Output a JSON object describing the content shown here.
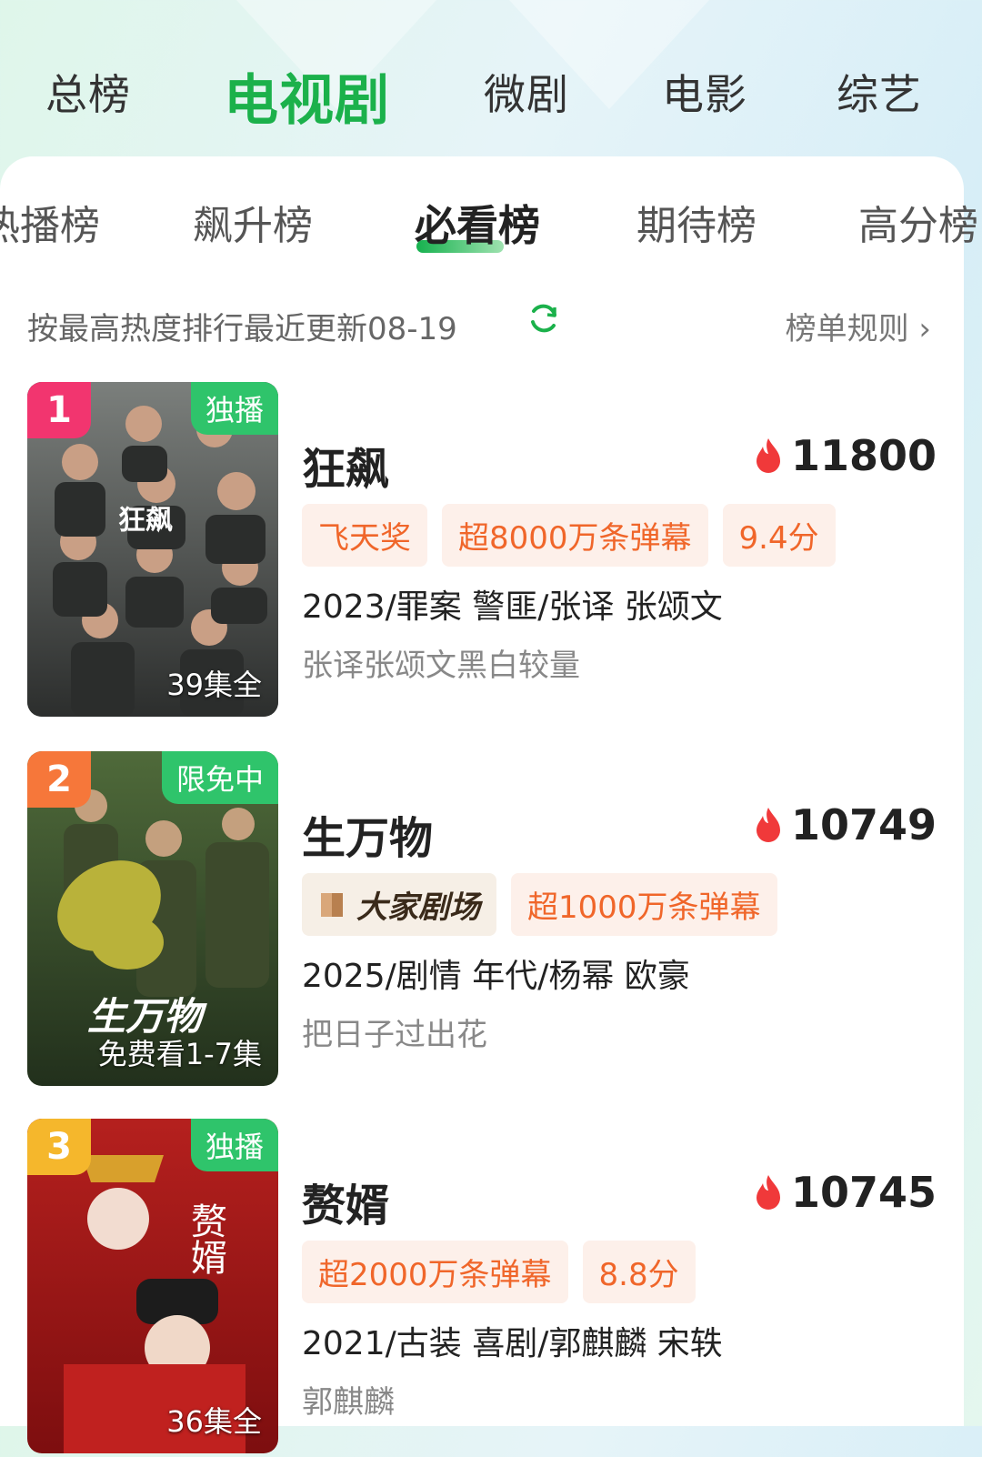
{
  "top_tabs": [
    "总榜",
    "电视剧",
    "微剧",
    "电影",
    "综艺"
  ],
  "sub_tabs": [
    "热播榜",
    "飙升榜",
    "必看榜",
    "期待榜",
    "高分榜"
  ],
  "info": {
    "sort_text": "按最高热度排行最近更新08-19",
    "rule_text": "榜单规则 ›"
  },
  "items": [
    {
      "rank": "1",
      "badge": "独播",
      "episodes": "39集全",
      "title": "狂飙",
      "heat": "11800",
      "tags": [
        "飞天奖",
        "超8000万条弹幕",
        "9.4分"
      ],
      "meta": "2023/罪案 警匪/张译 张颂文",
      "desc": "张译张颂文黑白较量",
      "poster_text": "狂飙"
    },
    {
      "rank": "2",
      "badge": "限免中",
      "episodes": "免费看1-7集",
      "title": "生万物",
      "heat": "10749",
      "tags": [
        "大家剧场",
        "超1000万条弹幕"
      ],
      "meta": "2025/剧情 年代/杨幂 欧豪",
      "desc": "把日子过出花",
      "poster_text": "生万物"
    },
    {
      "rank": "3",
      "badge": "独播",
      "episodes": "36集全",
      "title": "赘婿",
      "heat": "10745",
      "tags": [
        "超2000万条弹幕",
        "8.8分"
      ],
      "meta": "2021/古装 喜剧/郭麒麟 宋轶",
      "desc": "郭麒麟",
      "poster_text": "赘婿"
    }
  ],
  "colors": {
    "accent": "#1bb14b",
    "tag_text": "#f0662a",
    "tag_bg": "#fdf0ea",
    "rank1": "#f2356f",
    "rank2": "#f6773a",
    "rank3": "#f5b72c",
    "badge": "#2fc46b"
  }
}
